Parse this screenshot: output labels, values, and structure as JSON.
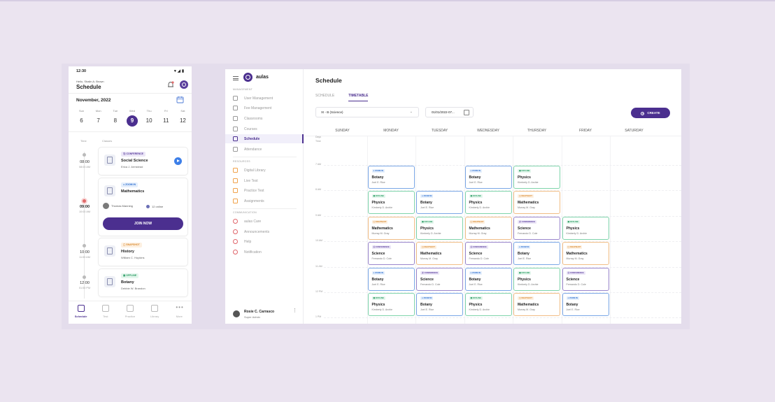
{
  "phone": {
    "status_time": "12:30",
    "status_icons": "▾◢▮",
    "greeting": "Hello, Shalin A. Brown",
    "title": "Schedule",
    "month": "November, 2022",
    "days": [
      {
        "name": "Sun",
        "date": "6"
      },
      {
        "name": "Mon",
        "date": "7"
      },
      {
        "name": "Tue",
        "date": "8"
      },
      {
        "name": "Wed",
        "date": "9"
      },
      {
        "name": "Thu",
        "date": "10"
      },
      {
        "name": "Fri",
        "date": "11"
      },
      {
        "name": "Sat",
        "date": "12"
      }
    ],
    "col_time": "Time",
    "col_classes": "Classes",
    "slots": [
      {
        "time": "08:00",
        "end": "08:00 AM"
      },
      {
        "time": "09:00",
        "end": "10:00 AM"
      },
      {
        "time": "10:00",
        "end": "11:00 AM"
      },
      {
        "time": "12:00",
        "end": "01:00 PM"
      }
    ],
    "cards": [
      {
        "tag": "Ⓐ CONFERENCE",
        "title": "Social Science",
        "teacher": "Erica J. Armstead"
      },
      {
        "tag": "● ZOOM IN",
        "title": "Mathematics",
        "host": "Thomas Manning",
        "online": "12 online",
        "join": "JOIN NOW"
      },
      {
        "tag": "▢ SNAPSHOT",
        "title": "History",
        "teacher": "William C. Hopkins"
      },
      {
        "tag": "▣ OFFLINE",
        "title": "Botany",
        "teacher": "Debbie W. Brandon"
      }
    ],
    "nav": [
      {
        "label": "Schedule"
      },
      {
        "label": "Test"
      },
      {
        "label": "Practice"
      },
      {
        "label": "Library"
      },
      {
        "label": "More"
      }
    ]
  },
  "desktop": {
    "app_name": "aulas",
    "groups": {
      "management": "MANAGEMENT",
      "resources": "RESOURCES",
      "communication": "COMMUNICATION"
    },
    "nav": {
      "user_mgmt": "User Management",
      "fee_mgmt": "Fee Management",
      "classrooms": "Classrooms",
      "courses": "Courses",
      "schedule": "Schedule",
      "attendance": "Attendance",
      "digital_library": "Digital Library",
      "live_test": "Live Test",
      "practice_test": "Practice Test",
      "assignments": "Assignments",
      "aulas_care": "aulas Care",
      "announcements": "Announcements",
      "help": "Help",
      "notification": "Notification"
    },
    "user": {
      "name": "Rosie C. Carrasco",
      "role": "Super Admin",
      "more": "⋮"
    },
    "title": "Schedule",
    "tabs": {
      "schedule": "SCHEDULE",
      "timetable": "TIMETABLE"
    },
    "class_select": "XI - B (Science)",
    "date": "01/01/2022-07...",
    "create": "CREATE",
    "days": [
      "SUNDAY",
      "MONDAY",
      "TUESDAY",
      "WEDNESDAY",
      "THURSDAY",
      "FRIDAY",
      "SATURDAY"
    ],
    "days_label": "Days",
    "time_label": "Time",
    "times": [
      "7 AM",
      "8 AM",
      "9 AM",
      "10 AM",
      "11 AM",
      "12 PM",
      "1 PM"
    ],
    "tags": {
      "conf": "Ⓐ CONFERENCE",
      "zoom": "● ZOOM IN",
      "off": "▣ OFFLINE",
      "snap": "▢ SNAPSHOT"
    }
  },
  "events": [
    {
      "col": 1,
      "row": 0,
      "kind": "botany",
      "tag": "zoom",
      "subject": "Botany",
      "teacher": "Joel E. Rice"
    },
    {
      "col": 3,
      "row": 0,
      "kind": "botany",
      "tag": "zoom",
      "subject": "Botany",
      "teacher": "Joel E. Rice"
    },
    {
      "col": 4,
      "row": 0,
      "kind": "physics",
      "tag": "off",
      "subject": "Physics",
      "teacher": "Kimberly D. Archie"
    },
    {
      "col": 1,
      "row": 1,
      "kind": "physics",
      "tag": "off",
      "subject": "Physics",
      "teacher": "Kimberly D. Archie"
    },
    {
      "col": 2,
      "row": 1,
      "kind": "botany",
      "tag": "zoom",
      "subject": "Botany",
      "teacher": "Joel E. Rice"
    },
    {
      "col": 3,
      "row": 1,
      "kind": "physics",
      "tag": "off",
      "subject": "Physics",
      "teacher": "Kimberly D. Archie"
    },
    {
      "col": 4,
      "row": 1,
      "kind": "math",
      "tag": "snap",
      "subject": "Mathematics",
      "teacher": "Murray M. Gray"
    },
    {
      "col": 1,
      "row": 2,
      "kind": "math",
      "tag": "snap",
      "subject": "Mathematics",
      "teacher": "Murray M. Gray"
    },
    {
      "col": 2,
      "row": 2,
      "kind": "physics",
      "tag": "off",
      "subject": "Physics",
      "teacher": "Kimberly D. Archie"
    },
    {
      "col": 3,
      "row": 2,
      "kind": "math",
      "tag": "snap",
      "subject": "Mathematics",
      "teacher": "Murray M. Gray"
    },
    {
      "col": 4,
      "row": 2,
      "kind": "science",
      "tag": "conf",
      "subject": "Science",
      "teacher": "Fernando D. Cole"
    },
    {
      "col": 5,
      "row": 2,
      "kind": "physics",
      "tag": "off",
      "subject": "Physics",
      "teacher": "Kimberly D. Archie"
    },
    {
      "col": 1,
      "row": 3,
      "kind": "science",
      "tag": "conf",
      "subject": "Science",
      "teacher": "Fernando D. Cole"
    },
    {
      "col": 2,
      "row": 3,
      "kind": "math",
      "tag": "snap",
      "subject": "Mathematics",
      "teacher": "Murray M. Gray"
    },
    {
      "col": 3,
      "row": 3,
      "kind": "science",
      "tag": "conf",
      "subject": "Science",
      "teacher": "Fernando D. Cole"
    },
    {
      "col": 4,
      "row": 3,
      "kind": "botany",
      "tag": "zoom",
      "subject": "Botany",
      "teacher": "Joel E. Rice"
    },
    {
      "col": 5,
      "row": 3,
      "kind": "math",
      "tag": "snap",
      "subject": "Mathematics",
      "teacher": "Murray M. Gray"
    },
    {
      "col": 1,
      "row": 4,
      "kind": "botany",
      "tag": "zoom",
      "subject": "Botany",
      "teacher": "Joel E. Rice"
    },
    {
      "col": 2,
      "row": 4,
      "kind": "science",
      "tag": "conf",
      "subject": "Science",
      "teacher": "Fernando D. Cole"
    },
    {
      "col": 3,
      "row": 4,
      "kind": "botany",
      "tag": "zoom",
      "subject": "Botany",
      "teacher": "Joel E. Rice"
    },
    {
      "col": 4,
      "row": 4,
      "kind": "physics",
      "tag": "off",
      "subject": "Physics",
      "teacher": "Kimberly D. Archie"
    },
    {
      "col": 5,
      "row": 4,
      "kind": "science",
      "tag": "conf",
      "subject": "Science",
      "teacher": "Fernando D. Cole"
    },
    {
      "col": 1,
      "row": 5,
      "kind": "physics",
      "tag": "off",
      "subject": "Physics",
      "teacher": "Kimberly D. Archie"
    },
    {
      "col": 2,
      "row": 5,
      "kind": "botany",
      "tag": "zoom",
      "subject": "Botany",
      "teacher": "Joel E. Rice"
    },
    {
      "col": 3,
      "row": 5,
      "kind": "physics",
      "tag": "off",
      "subject": "Physics",
      "teacher": "Kimberly D. Archie"
    },
    {
      "col": 4,
      "row": 5,
      "kind": "math",
      "tag": "snap",
      "subject": "Mathematics",
      "teacher": "Murray M. Gray"
    },
    {
      "col": 5,
      "row": 5,
      "kind": "botany",
      "tag": "zoom",
      "subject": "Botany",
      "teacher": "Joel E. Rice"
    }
  ],
  "colors": {
    "brand": "#4b2f8f",
    "accent_blue": "#3d7fe8",
    "live": "#e06a6a"
  },
  "icons": [
    "bell-icon",
    "calendar-icon",
    "play-icon",
    "menu-icon",
    "chevron-down-icon",
    "more-vertical-icon"
  ]
}
